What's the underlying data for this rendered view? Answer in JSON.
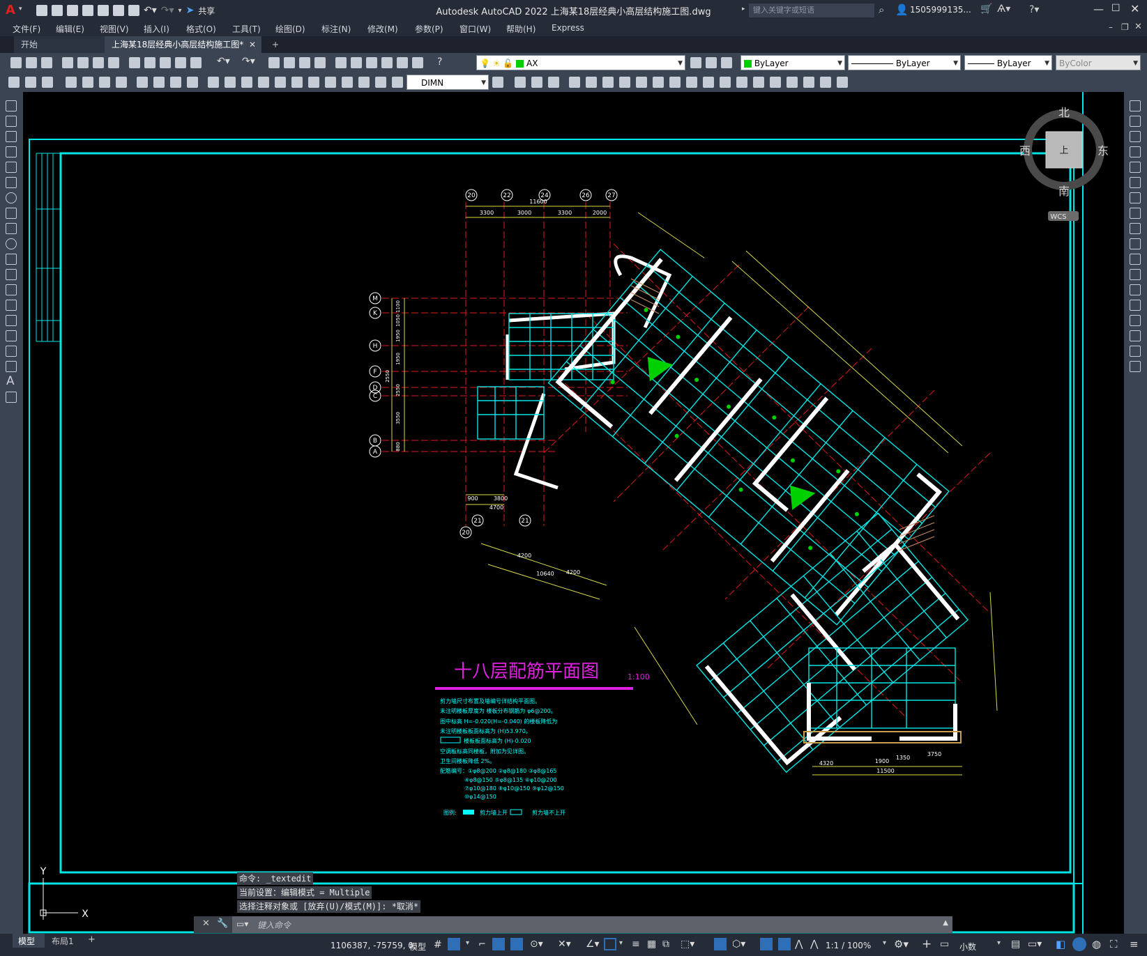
{
  "window": {
    "title": "Autodesk AutoCAD 2022    上海某18层经典小高层结构施工图.dwg",
    "share_label": "共享",
    "search_placeholder": "键入关键字或短语",
    "user": "1505999135..."
  },
  "menu": [
    "文件(F)",
    "编辑(E)",
    "视图(V)",
    "插入(I)",
    "格式(O)",
    "工具(T)",
    "绘图(D)",
    "标注(N)",
    "修改(M)",
    "参数(P)",
    "窗口(W)",
    "帮助(H)",
    "Express"
  ],
  "tabs": {
    "start": "开始",
    "doc": "上海某18层经典小高层结构施工图*",
    "add": "+"
  },
  "toolbar": {
    "layer": "AX",
    "color": "ByLayer",
    "linetype": "ByLayer",
    "lineweight": "ByLayer",
    "plotstyle": "ByColor",
    "dimstyle": "DIMN"
  },
  "viewcube": {
    "north": "北",
    "south": "南",
    "east": "东",
    "west": "西",
    "top": "上",
    "wcs": "WCS"
  },
  "drawing": {
    "title": "十八层配筋平面图",
    "scale": "1:100",
    "grid_top": [
      "20",
      "22",
      "24",
      "26",
      "27"
    ],
    "grid_bottom": [
      "20",
      "21",
      "21"
    ],
    "grid_left": [
      "M",
      "K",
      "H",
      "F",
      "D",
      "C",
      "B",
      "A"
    ],
    "dims_top": [
      "3300",
      "3000",
      "3300",
      "2000"
    ],
    "dim_top_total": "11600",
    "dims_left": [
      "1100",
      "1050",
      "1950",
      "1950",
      "2550",
      "2550",
      "3550",
      "880"
    ],
    "dims_bottom": [
      "900",
      "3800"
    ],
    "dim_bottom_total": "4700",
    "dims_lower": [
      "4200",
      "4200"
    ],
    "dim_lower_total": "10640",
    "dims_right_bottom": [
      "4320",
      "1900",
      "1350",
      "3750"
    ],
    "dim_right_total": "11500",
    "notes": [
      "剪力墙尺寸布置及墙编号详结构平面图。",
      "未注明楼板厚度为    楼板分布钢筋为 φ6@200。",
      "图中标高 H=-0.020(H=-0.040) 的楼板降低为",
      "未注明楼板板面标高为 (H)53.970。",
      "楼板板面标高为 (H)-0.020",
      "空调板标高同楼板，附加为见详图。",
      "卫生间楼板降低 2%。",
      "配筋编号：①φ8@200  ②φ8@180  ③φ8@165",
      "④φ8@150  ⑤φ8@135  ⑥φ10@200",
      "⑦φ10@180  ⑧φ10@150  ⑨φ12@150",
      "⑩φ14@150"
    ],
    "legend_label": "图例:",
    "legend_1": "剪力墙上开",
    "legend_2": "剪力墙不上开"
  },
  "ucs": {
    "y": "Y",
    "x": "X"
  },
  "command": {
    "history": [
      "命令:  _textedit",
      "当前设置：编辑模式 = Multiple",
      "选择注释对象或 [放弃(U)/模式(M)]: *取消*"
    ],
    "placeholder": "键入命令"
  },
  "status": {
    "coords": "1106387, -75759, 0",
    "space": "模型",
    "scale": "1:1 / 100%",
    "units": "小数",
    "tab_model": "模型",
    "tab_layout": "布局1",
    "tab_add": "+"
  }
}
